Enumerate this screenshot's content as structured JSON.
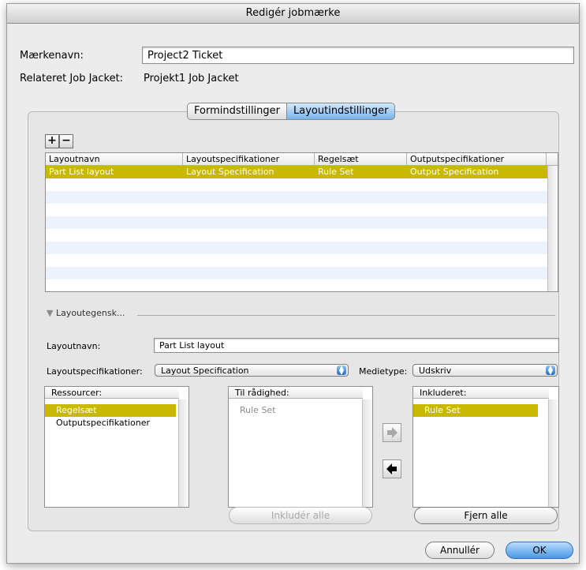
{
  "window": {
    "title": "Redigér jobmærke"
  },
  "header": {
    "name_label": "Mærkenavn:",
    "name_value": "Project2 Ticket",
    "related_label": "Relateret Job Jacket:",
    "related_value": "Projekt1 Job Jacket"
  },
  "tabs": [
    {
      "label": "Formindstillinger",
      "active": false
    },
    {
      "label": "Layoutindstillinger",
      "active": true
    }
  ],
  "toolbar": {
    "add_label": "+",
    "remove_label": "−"
  },
  "layout_table": {
    "columns": [
      "Layoutnavn",
      "Layoutspecifikationer",
      "Regelsæt",
      "Outputspecifikationer"
    ],
    "rows": [
      {
        "cells": [
          "Part List layout",
          "Layout Specification",
          "Rule Set",
          "Output Specification"
        ],
        "selected": true
      }
    ]
  },
  "properties": {
    "disclosure_label": "Layoutegensk...",
    "layout_name_label": "Layoutnavn:",
    "layout_name_value": "Part List layout",
    "spec_label": "Layoutspecifikationer:",
    "spec_value": "Layout Specification",
    "media_label": "Medietype:",
    "media_value": "Udskriv"
  },
  "resources_list": {
    "header": "Ressourcer:",
    "items": [
      {
        "label": "Regelsæt",
        "selected": true
      },
      {
        "label": "Outputspecifikationer",
        "selected": false
      }
    ]
  },
  "available_list": {
    "header": "Til rådighed:",
    "items": [
      {
        "label": "Rule Set",
        "selected": false
      }
    ]
  },
  "included_list": {
    "header": "Inkluderet:",
    "items": [
      {
        "label": "Rule Set",
        "selected": true
      }
    ]
  },
  "buttons": {
    "include_all": "Inkludér alle",
    "remove_all": "Fjern alle",
    "cancel": "Annullér",
    "ok": "OK"
  },
  "colors": {
    "selection": "#c8b800",
    "default_button": "#4b98e6"
  }
}
